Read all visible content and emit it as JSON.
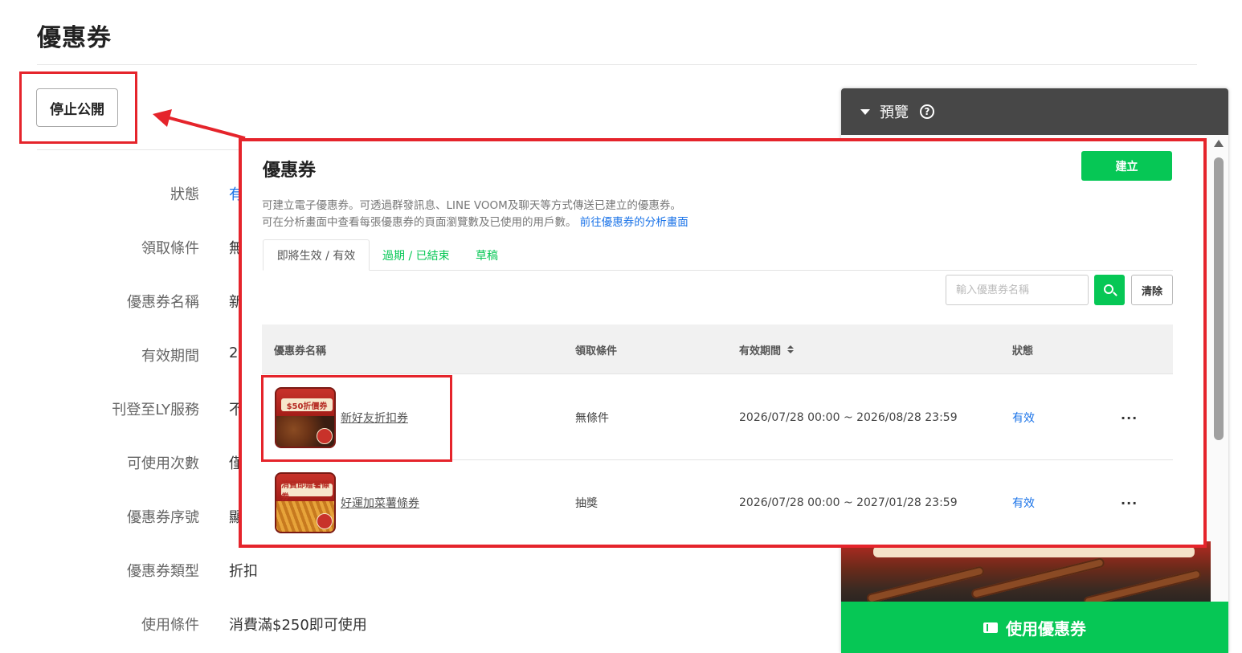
{
  "page": {
    "title": "優惠券",
    "stop_publish_label": "停止公開"
  },
  "form": {
    "fields": [
      {
        "label": "狀態",
        "value": "有"
      },
      {
        "label": "領取條件",
        "value": "無"
      },
      {
        "label": "優惠券名稱",
        "value": "新"
      },
      {
        "label": "有效期間",
        "value": "2"
      },
      {
        "label": "刊登至LY服務",
        "value": "不"
      },
      {
        "label": "可使用次數",
        "value": "僅"
      },
      {
        "label": "優惠券序號",
        "value": "顯"
      },
      {
        "label": "優惠券類型",
        "value": "折扣"
      },
      {
        "label": "使用條件",
        "value": "消費滿$250即可使用"
      }
    ]
  },
  "preview": {
    "title": "預覽",
    "help_icon": "?",
    "use_button_label": "使用優惠券"
  },
  "overlay": {
    "title": "優惠券",
    "create_label": "建立",
    "desc_line1": "可建立電子優惠券。可透過群發訊息、LINE VOOM及聊天等方式傳送已建立的優惠券。",
    "desc_line2": "可在分析畫面中查看每張優惠券的頁面瀏覽數及已使用的用戶數。",
    "analysis_link": "前往優惠券的分析畫面",
    "tabs": [
      {
        "label": "即將生效 / 有效"
      },
      {
        "label": "過期 / 已結束"
      },
      {
        "label": "草稿"
      }
    ],
    "search_placeholder": "輸入優惠券名稱",
    "clear_label": "清除",
    "table": {
      "headers": [
        "優惠券名稱",
        "領取條件",
        "有效期間",
        "狀態"
      ],
      "rows": [
        {
          "name": "新好友折扣券",
          "condition": "無條件",
          "period": "2026/07/28 00:00 ~ 2026/08/28 23:59",
          "status": "有效",
          "more": "···",
          "thumb_text": "$50折價券"
        },
        {
          "name": "好運加菜薯條券",
          "condition": "抽獎",
          "period": "2026/07/28 00:00 ~ 2027/01/28 23:59",
          "status": "有效",
          "more": "···",
          "thumb_text": "消費即贈薯條券"
        }
      ]
    }
  },
  "colors": {
    "accent_green": "#06c755",
    "annotation_red": "#e5242b",
    "link_blue": "#1a73e8",
    "preview_header": "#474747"
  }
}
